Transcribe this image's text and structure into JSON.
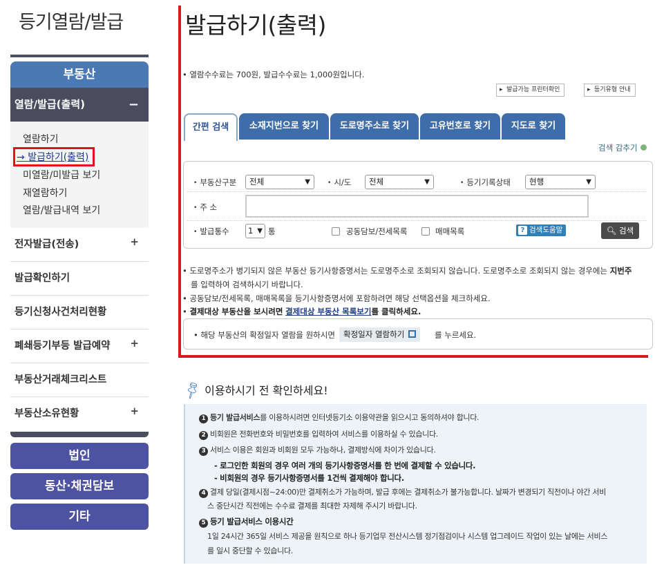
{
  "sidebar": {
    "title": "등기열람/발급",
    "category_realestate": "부동산",
    "active_menu": "열람/발급(출력)",
    "active_menu_toggle": "−",
    "sub_items": [
      "열람하기",
      "발급하기(출력)",
      "미열람/미발급 보기",
      "재열람하기",
      "열람/발급내역 보기"
    ],
    "selected_prefix": "→",
    "menu_rows": [
      {
        "label": "전자발급(전송)",
        "toggle": "+"
      },
      {
        "label": "발급확인하기",
        "toggle": ""
      },
      {
        "label": "등기신청사건처리현황",
        "toggle": ""
      },
      {
        "label": "폐쇄등기부등 발급예약",
        "toggle": "+"
      },
      {
        "label": "부동산거래체크리스트",
        "toggle": ""
      },
      {
        "label": "부동산소유현황",
        "toggle": "+"
      }
    ],
    "categories": [
      "법인",
      "동산·채권담보",
      "기타"
    ]
  },
  "main": {
    "title": "발급하기(출력)",
    "fee_note": "• 열람수수료는 700원, 발급수수료는 1,000원입니다.",
    "btn_printer": "발급가능 프린터확인",
    "btn_guide": "등기유형 안내",
    "tabs": [
      "간편 검색",
      "소재지번으로 찾기",
      "도로명주소로 찾기",
      "고유번호로 찾기",
      "지도로 찾기"
    ],
    "search_toggle": "검색 감추기",
    "form": {
      "property_type_label": "부동산구분",
      "property_type_value": "전체",
      "city_label": "시/도",
      "city_value": "전체",
      "record_status_label": "등기기록상태",
      "record_status_value": "현행",
      "address_label": "주 소",
      "address_value": "",
      "copies_label": "발급통수",
      "copies_value": "1",
      "copies_unit": "통",
      "check_collateral": "공동담보/전세목록",
      "check_sales": "매매목록",
      "help_button": "검색도움말",
      "help_icon": "?",
      "search_button": "검색"
    },
    "notes": {
      "n1": "도로명주소가 병기되지 않은 부동산 등기사항증명서는 도로명주소로 조회되지 않습니다. 도로명주소로 조회되지 않는 경우에는",
      "n1_bold": "지번주",
      "n1_cont": "를 입력하여 검색하시기 바랍니다.",
      "n2": "공동담보/전세목록, 매매목록을 등기사항증명서에 포함하려면 해당 선택옵션을 체크하세요.",
      "n3_a": "결제대상 부동산을 보시려면",
      "n3_link": "결제대상 부동산 목록보기",
      "n3_b": "를 클릭하세요."
    },
    "confirm": {
      "text_before": "• 해당 부동산의 확정일자 열람을 원하시면",
      "button": "확정일자 열람하기",
      "text_after": "를 누르세요."
    },
    "info": {
      "title": "이용하시기 전 확인하세요!",
      "lines": [
        {
          "num": "1",
          "bold": "등기 발급서비스",
          "text": "를 이용하시려면 인터넷등기소 이용약관을 읽으시고 동의하셔야 합니다."
        },
        {
          "num": "2",
          "bold": "",
          "text": "비회원은 전화번호와 비밀번호를 입력하여 서비스를 이용하실 수 있습니다."
        },
        {
          "num": "3",
          "bold": "",
          "text": "서비스 이용은 회원과 비회원 모두 가능하나, 결제방식에 차이가 있습니다."
        }
      ],
      "sub1": "- 로그인한 회원의 경우 여러 개의 등기사항증명서를 한 번에 결제할 수 있습니다.",
      "sub2": "- 비회원의 경우 등기사항증명서를 1건씩 결제해야 합니다.",
      "line4_num": "4",
      "line4": "결제 당일(결제시점~24:00)만 결제취소가 가능하며, 발급 후에는 결제취소가 불가능합니다. 날짜가 변경되기 직전이나 야간 서비",
      "line4_cont": "스 중단시간 직전에는 수수료 결제를 최대한 자제해 주시기 바랍니다.",
      "line5_num": "5",
      "line5": "등기 발급서비스 이용시간",
      "line6": "1일 24시간 365일 서비스 제공을 원칙으로 하나 등기업무 전산시스템 정기점검이나 시스템 업그레이드 작업이 있는 날에는 서비스",
      "line6_cont": "를 일시 중단할 수 있습니다."
    }
  },
  "colors": {
    "realestate_blue": "#4b79b3",
    "active_menu_dark": "#4a4b5d",
    "category_purple": "#4e52a2",
    "tab_blue": "#3f6da9",
    "highlight_red": "#d61a22"
  }
}
